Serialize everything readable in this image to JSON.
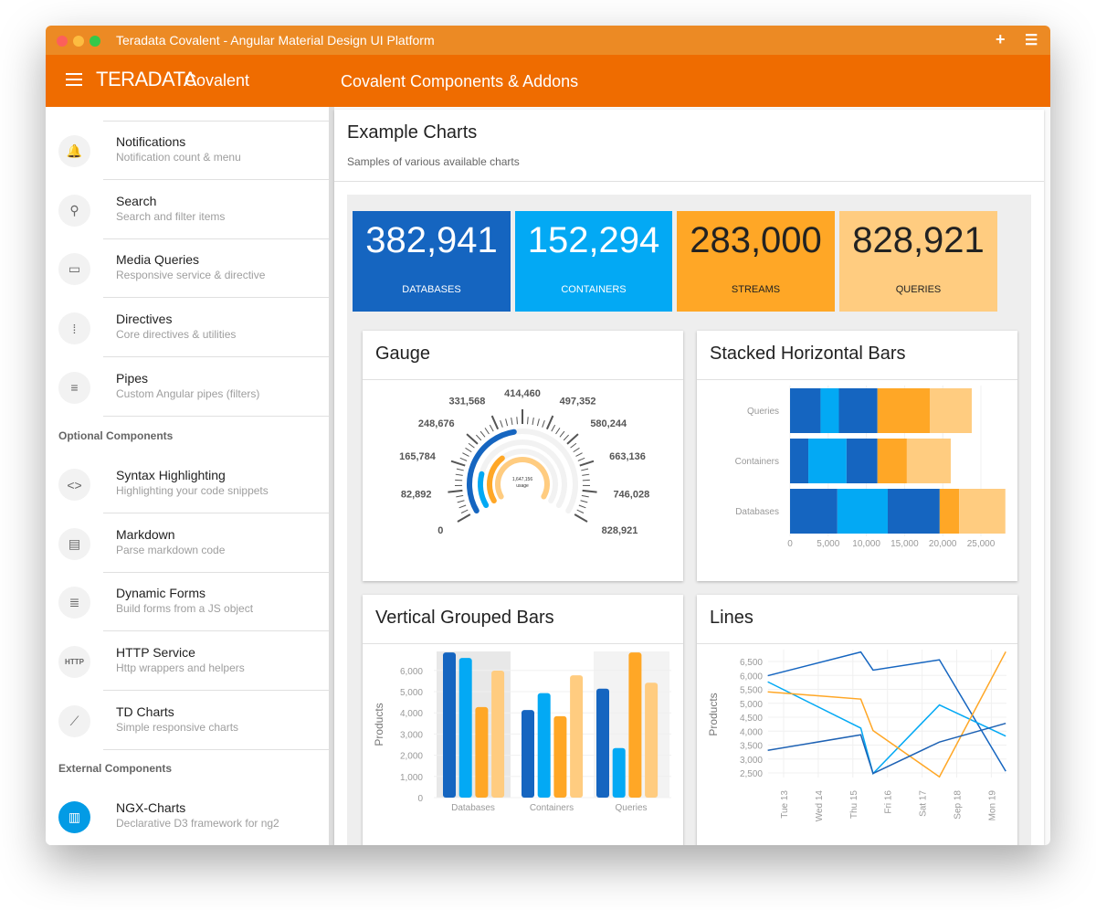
{
  "window": {
    "title": "Teradata Covalent - Angular Material Design UI Platform",
    "icons": [
      "plus-icon",
      "menu-icon"
    ]
  },
  "toolbar": {
    "logo": "TERADATA",
    "product": "Covalent",
    "title": "Covalent Components & Addons"
  },
  "sidebar": {
    "items": [
      {
        "label": "Notifications",
        "sub": "Notification count & menu",
        "icon": "bell-icon"
      },
      {
        "label": "Search",
        "sub": "Search and filter items",
        "icon": "search-icon"
      },
      {
        "label": "Media Queries",
        "sub": "Responsive service & directive",
        "icon": "devices-icon"
      },
      {
        "label": "Directives",
        "sub": "Core directives & utilities",
        "icon": "select-all-icon"
      },
      {
        "label": "Pipes",
        "sub": "Custom Angular pipes (filters)",
        "icon": "filter-icon"
      }
    ],
    "optional_header": "Optional Components",
    "optional": [
      {
        "label": "Syntax Highlighting",
        "sub": "Highlighting your code snippets",
        "icon": "code-icon"
      },
      {
        "label": "Markdown",
        "sub": "Parse markdown code",
        "icon": "chrome-reader-icon"
      },
      {
        "label": "Dynamic Forms",
        "sub": "Build forms from a JS object",
        "icon": "format-align-center-icon"
      },
      {
        "label": "HTTP Service",
        "sub": "Http wrappers and helpers",
        "icon": "http-icon",
        "icon_text": "HTTP"
      },
      {
        "label": "TD Charts",
        "sub": "Simple responsive charts",
        "icon": "show-chart-icon"
      }
    ],
    "external_header": "External Components",
    "external": [
      {
        "label": "NGX-Charts",
        "sub": "Declarative D3 framework for ng2",
        "icon": "insert-chart-icon"
      }
    ]
  },
  "page": {
    "title": "Example Charts",
    "subtitle": "Samples of various available charts"
  },
  "colors": {
    "accent": "#ef6c00",
    "blue": "#1565c0",
    "light_blue": "#03a9f4",
    "orange": "#ffa726",
    "light_orange": "#ffcc80"
  },
  "kpis": [
    {
      "value": "382,941",
      "label": "DATABASES",
      "color": "#1565c0"
    },
    {
      "value": "152,294",
      "label": "CONTAINERS",
      "color": "#03a9f4"
    },
    {
      "value": "283,000",
      "label": "STREAMS",
      "color": "#ffa726"
    },
    {
      "value": "828,921",
      "label": "QUERIES",
      "color": "#ffcc80"
    }
  ],
  "chart_data": [
    {
      "title": "Gauge",
      "type": "gauge",
      "max": 828921,
      "ticks": [
        "0",
        "82,892",
        "165,784",
        "248,676",
        "331,568",
        "414,460",
        "497,352",
        "580,244",
        "663,136",
        "746,028",
        "828,921"
      ],
      "values": [
        382941,
        152294,
        283000,
        828921
      ],
      "colors": [
        "#1565c0",
        "#03a9f4",
        "#ffa726",
        "#ffcc80"
      ],
      "center_value": "1,647,156",
      "center_label": "usage"
    },
    {
      "title": "Stacked Horizontal Bars",
      "type": "bar",
      "orientation": "horizontal",
      "stacked": true,
      "categories": [
        "Queries",
        "Containers",
        "Databases"
      ],
      "series": [
        {
          "values": [
            4000,
            2400,
            6200
          ],
          "color": "#1565c0"
        },
        {
          "values": [
            2400,
            5000,
            6600
          ],
          "color": "#03a9f4"
        },
        {
          "values": [
            5050,
            4050,
            6800
          ],
          "color": "#1565c0"
        },
        {
          "values": [
            6850,
            3850,
            2550
          ],
          "color": "#ffa726"
        },
        {
          "values": [
            5500,
            5750,
            6050
          ],
          "color": "#ffcc80"
        }
      ],
      "xlim": [
        0,
        28200
      ],
      "xticks": [
        "0",
        "5,000",
        "10,000",
        "15,000",
        "20,000",
        "25,000"
      ],
      "grid": true
    },
    {
      "title": "Vertical Grouped Bars",
      "type": "bar",
      "orientation": "vertical",
      "categories": [
        "Databases",
        "Containers",
        "Queries"
      ],
      "series": [
        {
          "values": [
            6850,
            4130,
            5140
          ],
          "color": "#1565c0"
        },
        {
          "values": [
            6590,
            4930,
            2340
          ],
          "color": "#03a9f4"
        },
        {
          "values": [
            4270,
            3840,
            6850
          ],
          "color": "#ffa726"
        },
        {
          "values": [
            5990,
            5770,
            5420
          ],
          "color": "#ffcc80"
        }
      ],
      "ylabel": "Products",
      "ylim": [
        0,
        6900
      ],
      "yticks": [
        "0",
        "1,000",
        "2,000",
        "3,000",
        "4,000",
        "5,000",
        "6,000"
      ],
      "grid": true
    },
    {
      "title": "Lines",
      "type": "line",
      "x": [
        "Sep 12 13:00",
        "Sep 15 05:30",
        "Sep 15 14:00",
        "Sep 17 12:00",
        "Sep 19 10:00"
      ],
      "series": [
        {
          "values": [
            5990,
            6840,
            6190,
            6560,
            2560
          ],
          "color": "#1565c0"
        },
        {
          "values": [
            5770,
            4110,
            2480,
            4940,
            3820
          ],
          "color": "#03a9f4"
        },
        {
          "values": [
            5410,
            5150,
            4020,
            2360,
            6850
          ],
          "color": "#ffa726"
        },
        {
          "values": [
            3310,
            3870,
            2480,
            3610,
            4280
          ],
          "color": "#1e62b4"
        }
      ],
      "ylabel": "Products",
      "ylim": [
        2350,
        6900
      ],
      "yticks": [
        "2,500",
        "3,000",
        "3,500",
        "4,000",
        "4,500",
        "5,000",
        "5,500",
        "6,000",
        "6,500"
      ],
      "xticks": [
        "Tue 13",
        "Wed 14",
        "Thu 15",
        "Fri 16",
        "Sat 17",
        "Sep 18",
        "Mon 19"
      ],
      "grid": true
    }
  ]
}
